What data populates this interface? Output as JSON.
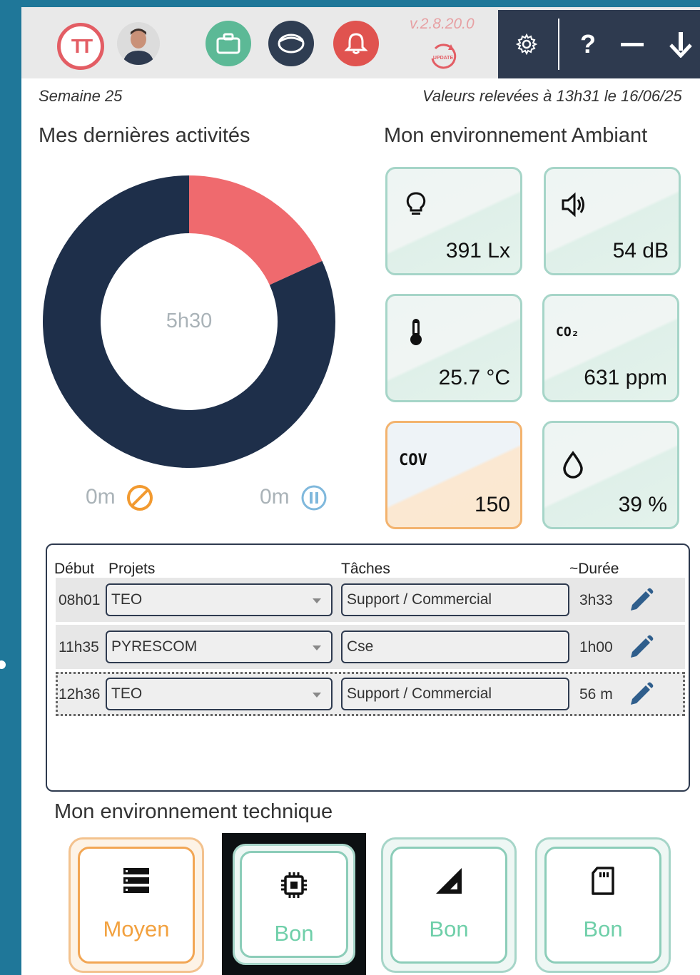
{
  "header": {
    "logo_text": "TT",
    "version": "v.2.8.20.0",
    "update_label": "UPDATE",
    "help_label": "?"
  },
  "week_label": "Semaine 25",
  "readings_label": "Valeurs relevées à 13h31 le 16/06/25",
  "activities": {
    "title": "Mes dernières activités",
    "total": "5h30",
    "blocked_time": "0m",
    "paused_time": "0m",
    "chart_data": {
      "type": "pie",
      "values": [
        4.5,
        1.0
      ],
      "colors": [
        "#1e2f4a",
        "#ef6a6e"
      ],
      "center_label": "5h30"
    }
  },
  "ambient": {
    "title": "Mon environnement Ambiant",
    "tiles": [
      {
        "icon": "lightbulb-icon",
        "value": "391 Lx",
        "state": "ok"
      },
      {
        "icon": "speaker-icon",
        "value": "54 dB",
        "state": "ok"
      },
      {
        "icon": "thermometer-icon",
        "value": "25.7 °C",
        "state": "ok"
      },
      {
        "icon": "co2-icon",
        "label": "CO₂",
        "value": "631 ppm",
        "state": "ok"
      },
      {
        "icon": "cov-icon",
        "label": "COV",
        "value": "150",
        "state": "warn"
      },
      {
        "icon": "drop-icon",
        "value": "39 %",
        "state": "ok"
      }
    ]
  },
  "table": {
    "headers": {
      "start": "Début",
      "project": "Projets",
      "task": "Tâches",
      "duration": "~Durée"
    },
    "rows": [
      {
        "start": "08h01",
        "project": "TEO",
        "task": "Support / Commercial",
        "duration": "3h33"
      },
      {
        "start": "11h35",
        "project": "PYRESCOM",
        "task": "Cse",
        "duration": "1h00"
      },
      {
        "start": "12h36",
        "project": "TEO",
        "task": "Support / Commercial",
        "duration": "56 m"
      }
    ]
  },
  "technical": {
    "title": "Mon environnement technique",
    "items": [
      {
        "icon": "server-icon",
        "status": "Moyen",
        "state": "warn"
      },
      {
        "icon": "cpu-icon",
        "status": "Bon",
        "state": "ok"
      },
      {
        "icon": "signal-icon",
        "status": "Bon",
        "state": "ok"
      },
      {
        "icon": "sd-card-icon",
        "status": "Bon",
        "state": "ok"
      }
    ]
  },
  "colors": {
    "background": "#1f7799",
    "navy": "#2e3a4f",
    "accent_red": "#e35d64",
    "green": "#5cb996",
    "warn_orange": "#f2a13f",
    "ok_green": "#6fcfa9"
  }
}
